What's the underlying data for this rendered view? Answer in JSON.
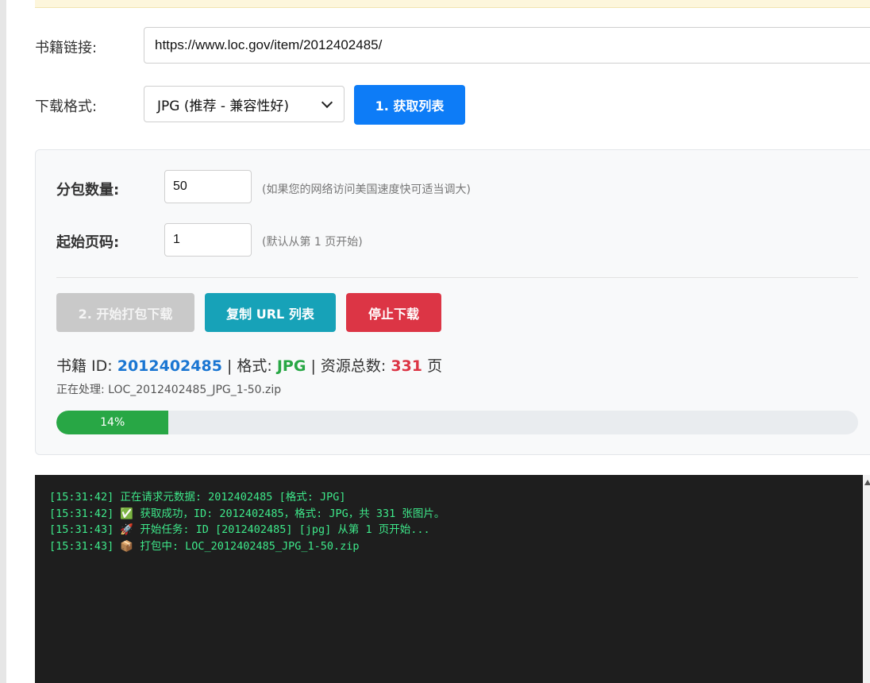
{
  "form": {
    "url_label": "书籍链接:",
    "url_value": "https://www.loc.gov/item/2012402485/",
    "format_label": "下载格式:",
    "format_selected": "JPG (推荐 - 兼容性好)",
    "fetch_button": "1. 获取列表"
  },
  "panel": {
    "batch_label": "分包数量:",
    "batch_value": "50",
    "batch_hint": "(如果您的网络访问美国速度快可适当调大)",
    "start_label": "起始页码:",
    "start_value": "1",
    "start_hint": "(默认从第 1 页开始)",
    "buttons": {
      "start": "2. 开始打包下载",
      "copy": "复制 URL 列表",
      "stop": "停止下载"
    },
    "info": {
      "id_label": "书籍 ID: ",
      "id_value": "2012402485",
      "sep1": " | 格式: ",
      "format_value": "JPG",
      "sep2": " | 资源总数: ",
      "count_value": "331",
      "unit": " 页"
    },
    "processing": "正在处理: LOC_2012402485_JPG_1-50.zip",
    "progress": {
      "percent": 14,
      "label": "14%"
    }
  },
  "console": {
    "lines": [
      "[15:31:42] 正在请求元数据: 2012402485 [格式: JPG]",
      "[15:31:42] ✅ 获取成功，ID: 2012402485，格式: JPG，共 331 张图片。",
      "[15:31:43] 🚀 开始任务: ID [2012402485] [jpg] 从第 1 页开始...",
      "[15:31:43] 📦 打包中: LOC_2012402485_JPG_1-50.zip"
    ]
  },
  "colors": {
    "primary": "#0d7cf7",
    "info": "#17a2b8",
    "danger": "#dc3545",
    "success": "#28a745",
    "console_text": "#3ee88a"
  }
}
